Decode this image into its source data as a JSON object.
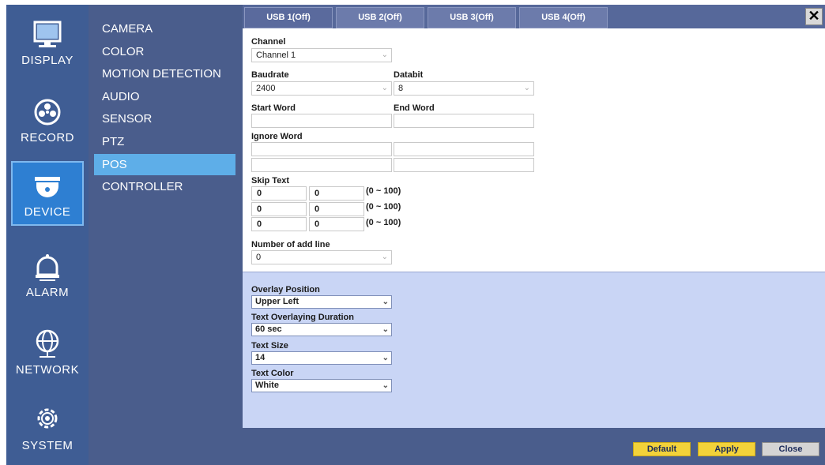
{
  "rail": [
    {
      "label": "DISPLAY",
      "icon": "monitor-icon"
    },
    {
      "label": "RECORD",
      "icon": "film-reel-icon"
    },
    {
      "label": "DEVICE",
      "icon": "dome-camera-icon"
    },
    {
      "label": "ALARM",
      "icon": "bell-icon"
    },
    {
      "label": "NETWORK",
      "icon": "globe-icon"
    },
    {
      "label": "SYSTEM",
      "icon": "gear-icon"
    }
  ],
  "submenu": [
    "CAMERA",
    "COLOR",
    "MOTION DETECTION",
    "AUDIO",
    "SENSOR",
    "PTZ",
    "POS",
    "CONTROLLER"
  ],
  "tabs": [
    "USB 1(Off)",
    "USB 2(Off)",
    "USB 3(Off)",
    "USB 4(Off)"
  ],
  "close_glyph": "✕",
  "form": {
    "channel_label": "Channel",
    "channel_value": "Channel 1",
    "baudrate_label": "Baudrate",
    "baudrate_value": "2400",
    "databit_label": "Databit",
    "databit_value": "8",
    "start_word_label": "Start Word",
    "end_word_label": "End Word",
    "ignore_word_label": "Ignore Word",
    "skip_text_label": "Skip Text",
    "skip_rows": [
      {
        "a": "0",
        "b": "0",
        "range": "(0 ~ 100)"
      },
      {
        "a": "0",
        "b": "0",
        "range": "(0 ~ 100)"
      },
      {
        "a": "0",
        "b": "0",
        "range": "(0 ~ 100)"
      }
    ],
    "add_line_label": "Number of add line",
    "add_line_value": "0"
  },
  "overlay": {
    "position_label": "Overlay Position",
    "position_value": "Upper Left",
    "duration_label": "Text Overlaying Duration",
    "duration_value": "60 sec",
    "size_label": "Text Size",
    "size_value": "14",
    "color_label": "Text Color",
    "color_value": "White"
  },
  "buttons": {
    "default": "Default",
    "apply": "Apply",
    "close": "Close"
  },
  "colors": {
    "rail_bg": "#3f5d94",
    "active_rail": "#2e7fd2",
    "active_submenu": "#5eaee8",
    "overlay_bg": "#c9d5f5",
    "button_yellow": "#f2d23a"
  }
}
